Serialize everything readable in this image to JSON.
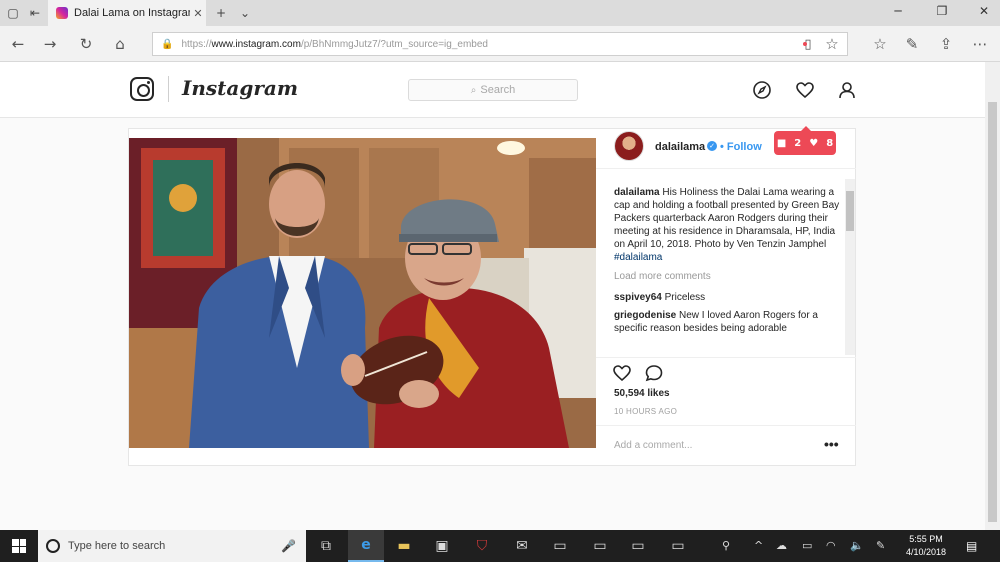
{
  "browser": {
    "tab_title": "Dalai Lama on Instagran",
    "url_prefix": "https://",
    "url_domain": "www.instagram.com",
    "url_path": "/p/BhNmmgJutz7/?utm_source=ig_embed"
  },
  "instagram": {
    "wordmark": "Instagram",
    "search_placeholder": "Search",
    "notifications": {
      "comments": "2",
      "likes": "8"
    }
  },
  "post": {
    "username": "dalailama",
    "follow_separator": "•",
    "follow_label": "Follow",
    "caption": {
      "user": "dalailama",
      "text": " His Holiness the Dalai Lama wearing a cap and holding a football presented by Green Bay Packers quarterback Aaron Rodgers during their meeting at his residence in Dharamsala, HP, India on April 10, 2018. Photo by Ven Tenzin Jamphel ",
      "hashtag": "#dalailama"
    },
    "load_more": "Load more comments",
    "comments": [
      {
        "user": "sspivey64",
        "text": " Priceless"
      },
      {
        "user": "griegodenise",
        "text": " New I loved Aaron Rogers for a specific reason besides being adorable"
      }
    ],
    "likes": "50,594 likes",
    "time": "10 HOURS AGO",
    "add_comment_placeholder": "Add a comment...",
    "more_options": "•••"
  },
  "taskbar": {
    "search_placeholder": "Type here to search",
    "time": "5:55 PM",
    "date": "4/10/2018"
  }
}
